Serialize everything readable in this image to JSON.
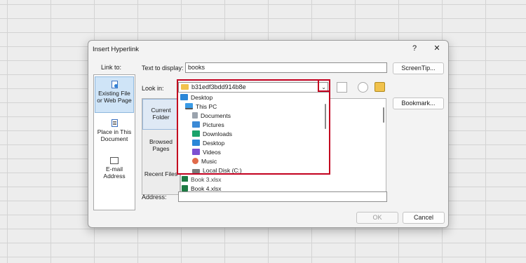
{
  "dialog": {
    "title": "Insert Hyperlink",
    "help": "?",
    "close": "✕"
  },
  "link_to": {
    "label": "Link to:",
    "items": [
      "Existing File or Web Page",
      "Place in This Document",
      "E-mail Address"
    ]
  },
  "text_to_display": {
    "label": "Text to display:",
    "value": "books",
    "screentip_button": "ScreenTip..."
  },
  "look_in": {
    "label": "Look in:",
    "value": "b31edf3bdd914b8e"
  },
  "nav": {
    "items": [
      "Current Folder",
      "Browsed Pages",
      "Recent Files"
    ]
  },
  "dropdown": {
    "items": [
      "Desktop",
      "This PC",
      "Documents",
      "Pictures",
      "Downloads",
      "Desktop",
      "Videos",
      "Music",
      "Local Disk (C:)"
    ]
  },
  "files": {
    "partial": "Book 3.xlsx",
    "item": "Book 4.xlsx"
  },
  "bookmark_button": "Bookmark...",
  "address": {
    "label": "Address:",
    "value": ""
  },
  "footer": {
    "ok": "OK",
    "cancel": "Cancel"
  },
  "colors": {
    "highlight_box": "#c3001f",
    "selection": "#cfe4f7"
  }
}
